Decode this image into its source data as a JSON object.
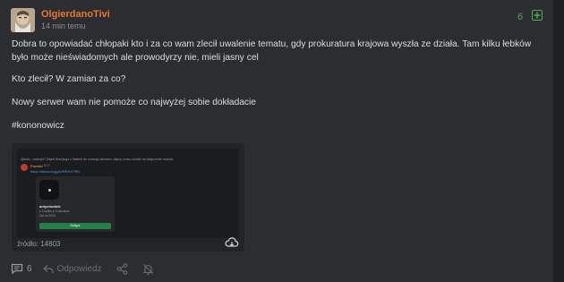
{
  "post": {
    "username": "OlgierdanoTivi",
    "time": "14 min temu",
    "votes": "6",
    "paragraphs": [
      "Dobra to opowiadać chłopaki kto i za co wam zlecił uwalenie tematu, gdy prokuratura krajowa wyszła ze działa. Tam kilku łebków było może nieświadomych ale prowodyrzy nie, mieli jasny cel",
      "Kto zlecił? W zamian za co?",
      "Nowy serwer wam nie pomoże co najwyżej sobie dokładacie",
      "#kononowicz"
    ]
  },
  "embed": {
    "source_label": "źródło: 14803",
    "screenshot": {
      "reply_line": "@kolo-- czarnjol? Zapeł Kiwi jingo z linkiem do nowego serwera, dajmy czasu chwile na dołączenie reszcie.",
      "author": "Formbi",
      "author_tag": "BOT",
      "link": "https://discord.gg/k2RRHXTRh",
      "server_name": "antychodnik",
      "server_stats": "● 3 online  ● 3 członków",
      "server_date": "Zał. lut 2024",
      "join_label": "Dołącz"
    }
  },
  "footer": {
    "comments_count": "6",
    "reply_label": "Odpowiedz"
  },
  "colors": {
    "accent_orange": "#e9772f",
    "vote_green": "#4caf50",
    "discord_join_green": "#248046"
  }
}
